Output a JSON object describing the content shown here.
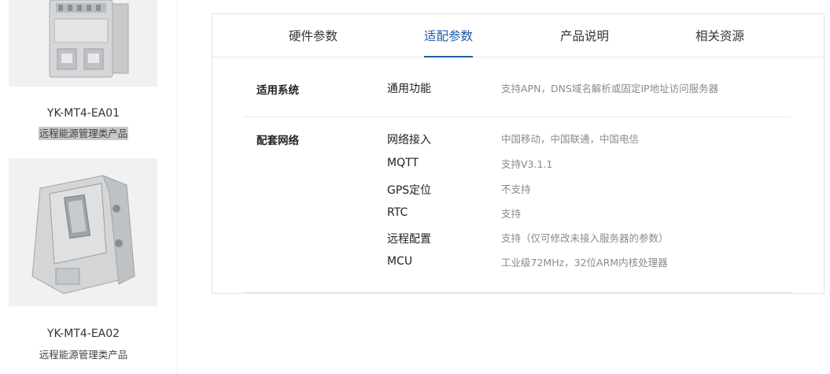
{
  "products": [
    {
      "name": "YK-MT4-EA01",
      "category": "远程能源管理类产品"
    },
    {
      "name": "YK-MT4-EA02",
      "category": "远程能源管理类产品"
    }
  ],
  "tabs": [
    {
      "label": "硬件参数"
    },
    {
      "label": "适配参数"
    },
    {
      "label": "产品说明"
    },
    {
      "label": "相关资源"
    }
  ],
  "active_tab": "适配参数",
  "specs": [
    {
      "section": "适用系统",
      "rows": [
        {
          "key": "通用功能",
          "value": "支持APN，DNS域名解析或固定IP地址访问服务器"
        }
      ]
    },
    {
      "section": "配套网络",
      "rows": [
        {
          "key": "网络接入",
          "value": "中国移动，中国联通，中国电信"
        },
        {
          "key": "MQTT",
          "value": "支持V3.1.1"
        },
        {
          "key": "GPS定位",
          "value": "不支持"
        },
        {
          "key": "RTC",
          "value": "支持"
        },
        {
          "key": "远程配置",
          "value": "支持（仅可修改未接入服务器的参数）"
        },
        {
          "key": "MCU",
          "value": "工业级72MHz，32位ARM内核处理器"
        }
      ]
    }
  ],
  "colors": {
    "accent": "#1f5aa6",
    "value_text": "#8a8a8a"
  }
}
